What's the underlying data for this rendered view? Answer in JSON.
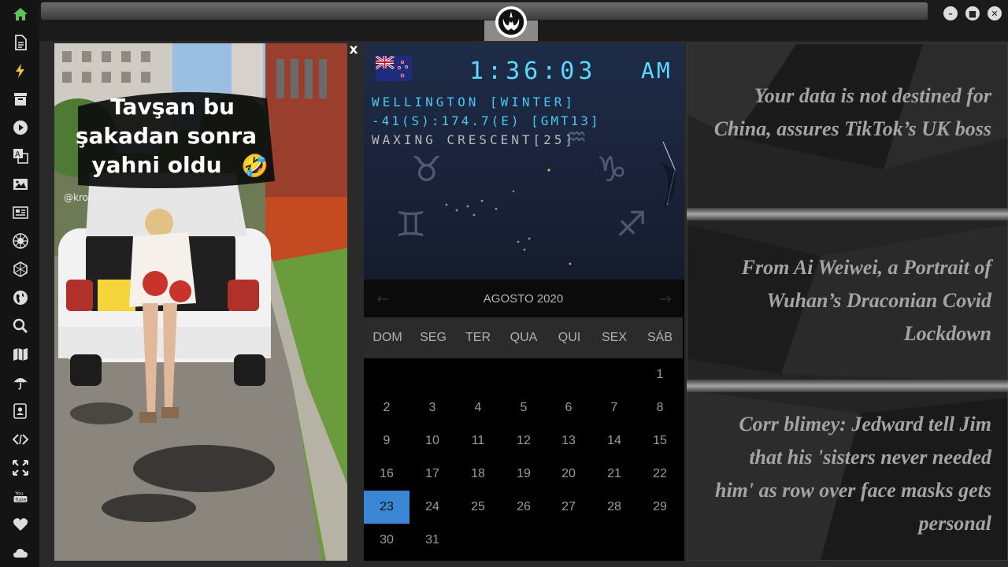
{
  "sidebar": {
    "items": [
      {
        "name": "home-icon"
      },
      {
        "name": "document-icon"
      },
      {
        "name": "lightning-icon"
      },
      {
        "name": "archive-icon"
      },
      {
        "name": "play-icon"
      },
      {
        "name": "translate-icon"
      },
      {
        "name": "image-icon"
      },
      {
        "name": "newspaper-icon"
      },
      {
        "name": "rebel-icon"
      },
      {
        "name": "hexagon-icon"
      },
      {
        "name": "globe-icon"
      },
      {
        "name": "search-icon"
      },
      {
        "name": "map-icon"
      },
      {
        "name": "umbrella-icon"
      },
      {
        "name": "contact-icon"
      },
      {
        "name": "code-icon"
      },
      {
        "name": "fullscreen-icon"
      },
      {
        "name": "youtube-icon",
        "label": "You Tube"
      },
      {
        "name": "heart-icon"
      },
      {
        "name": "cloud-icon"
      }
    ]
  },
  "video": {
    "caption_lines": [
      "Tavşan bu",
      "şakadan sonra",
      "yahni oldu"
    ],
    "emoji": "🤣",
    "handle": "@krolikilora"
  },
  "clock": {
    "time": "1:36:03",
    "ampm": "AM",
    "city": "WELLINGTON [WINTER]",
    "coords": "-41(S):174.7(E) [GMT13]",
    "moon": "WAXING CRESCENT[25]"
  },
  "calendar": {
    "month_label": "AGOSTO 2020",
    "prev": "←",
    "next": "→",
    "weekdays": [
      "DOM",
      "SEG",
      "TER",
      "QUA",
      "QUI",
      "SEX",
      "SÁB"
    ],
    "first_weekday_index": 6,
    "days_in_month": 31,
    "selected_day": 23,
    "selected_color": "#3a86d4"
  },
  "news": [
    {
      "headline": "Your data is not destined for China, assures TikTok’s UK boss"
    },
    {
      "headline": "From Ai Weiwei, a Portrait of Wuhan’s Draconian Covid Lockdown"
    },
    {
      "headline": "Corr blimey: Jedward tell Jim that his 'sisters never needed him' as row over face masks gets personal"
    }
  ],
  "colors": {
    "accent": "#4fd3ff",
    "sidebar_active": "#5ec45e"
  }
}
